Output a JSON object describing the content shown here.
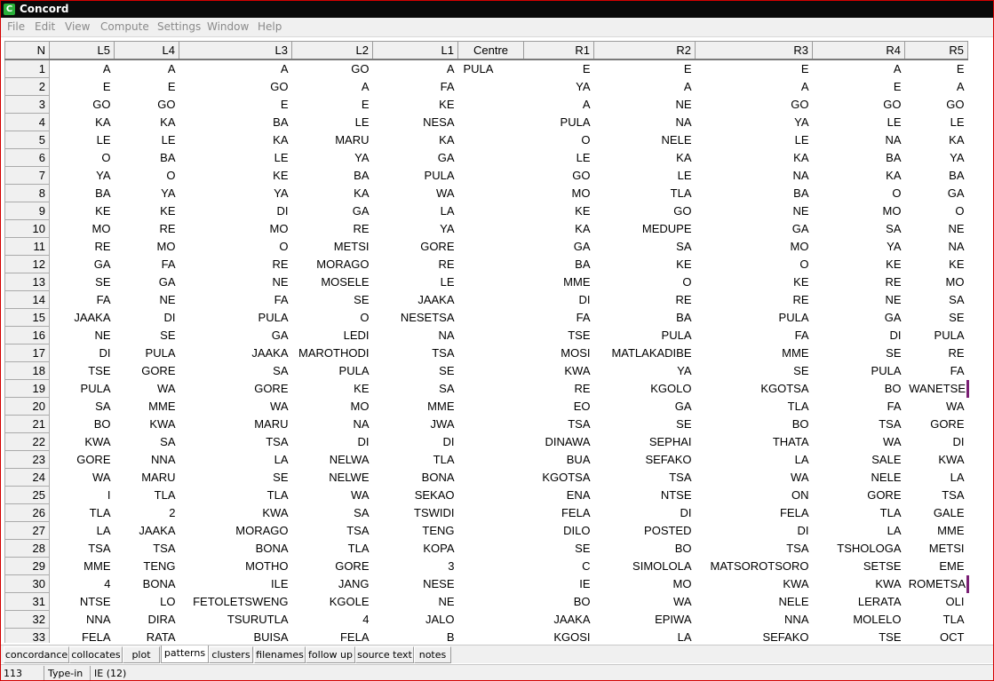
{
  "window": {
    "title": "Concord",
    "icon_letter": "C"
  },
  "menu": [
    "File",
    "Edit",
    "View",
    "Compute",
    "Settings",
    "Window",
    "Help"
  ],
  "columns": [
    "N",
    "L5",
    "L4",
    "L3",
    "L2",
    "L1",
    "Centre",
    "R1",
    "R2",
    "R3",
    "R4",
    "R5"
  ],
  "centre_word": "PULA",
  "rows": [
    [
      "1",
      "A",
      "A",
      "A",
      "GO",
      "A",
      "PULA",
      "E",
      "E",
      "E",
      "A",
      "E"
    ],
    [
      "2",
      "E",
      "E",
      "GO",
      "A",
      "FA",
      "",
      "YA",
      "A",
      "A",
      "E",
      "A"
    ],
    [
      "3",
      "GO",
      "GO",
      "E",
      "E",
      "KE",
      "",
      "A",
      "NE",
      "GO",
      "GO",
      "GO"
    ],
    [
      "4",
      "KA",
      "KA",
      "BA",
      "LE",
      "NESA",
      "",
      "PULA",
      "NA",
      "YA",
      "LE",
      "LE"
    ],
    [
      "5",
      "LE",
      "LE",
      "KA",
      "MARU",
      "KA",
      "",
      "O",
      "NELE",
      "LE",
      "NA",
      "KA"
    ],
    [
      "6",
      "O",
      "BA",
      "LE",
      "YA",
      "GA",
      "",
      "LE",
      "KA",
      "KA",
      "BA",
      "YA"
    ],
    [
      "7",
      "YA",
      "O",
      "KE",
      "BA",
      "PULA",
      "",
      "GO",
      "LE",
      "NA",
      "KA",
      "BA"
    ],
    [
      "8",
      "BA",
      "YA",
      "YA",
      "KA",
      "WA",
      "",
      "MO",
      "TLA",
      "BA",
      "O",
      "GA"
    ],
    [
      "9",
      "KE",
      "KE",
      "DI",
      "GA",
      "LA",
      "",
      "KE",
      "GO",
      "NE",
      "MO",
      "O"
    ],
    [
      "10",
      "MO",
      "RE",
      "MO",
      "RE",
      "YA",
      "",
      "KA",
      "MEDUPE",
      "GA",
      "SA",
      "NE"
    ],
    [
      "11",
      "RE",
      "MO",
      "O",
      "METSI",
      "GORE",
      "",
      "GA",
      "SA",
      "MO",
      "YA",
      "NA"
    ],
    [
      "12",
      "GA",
      "FA",
      "RE",
      "MORAGO",
      "RE",
      "",
      "BA",
      "KE",
      "O",
      "KE",
      "KE"
    ],
    [
      "13",
      "SE",
      "GA",
      "NE",
      "MOSELE",
      "LE",
      "",
      "MME",
      "O",
      "KE",
      "RE",
      "MO"
    ],
    [
      "14",
      "FA",
      "NE",
      "FA",
      "SE",
      "JAAKA",
      "",
      "DI",
      "RE",
      "RE",
      "NE",
      "SA"
    ],
    [
      "15",
      "JAAKA",
      "DI",
      "PULA",
      "O",
      "NESETSA",
      "",
      "FA",
      "BA",
      "PULA",
      "GA",
      "SE"
    ],
    [
      "16",
      "NE",
      "SE",
      "GA",
      "LEDI",
      "NA",
      "",
      "TSE",
      "PULA",
      "FA",
      "DI",
      "PULA"
    ],
    [
      "17",
      "DI",
      "PULA",
      "JAAKA",
      "MAROTHODI",
      "TSA",
      "",
      "MOSI",
      "MATLAKADIBE",
      "MME",
      "SE",
      "RE"
    ],
    [
      "18",
      "TSE",
      "GORE",
      "SA",
      "PULA",
      "SE",
      "",
      "KWA",
      "YA",
      "SE",
      "PULA",
      "FA"
    ],
    [
      "19",
      "PULA",
      "WA",
      "GORE",
      "KE",
      "SA",
      "",
      "RE",
      "KGOLO",
      "KGOTSA",
      "BO",
      "WANETSE"
    ],
    [
      "20",
      "SA",
      "MME",
      "WA",
      "MO",
      "MME",
      "",
      "EO",
      "GA",
      "TLA",
      "FA",
      "WA"
    ],
    [
      "21",
      "BO",
      "KWA",
      "MARU",
      "NA",
      "JWA",
      "",
      "TSA",
      "SE",
      "BO",
      "TSA",
      "GORE"
    ],
    [
      "22",
      "KWA",
      "SA",
      "TSA",
      "DI",
      "DI",
      "",
      "DINAWA",
      "SEPHAI",
      "THATA",
      "WA",
      "DI"
    ],
    [
      "23",
      "GORE",
      "NNA",
      "LA",
      "NELWA",
      "TLA",
      "",
      "BUA",
      "SEFAKO",
      "LA",
      "SALE",
      "KWA"
    ],
    [
      "24",
      "WA",
      "MARU",
      "SE",
      "NELWE",
      "BONA",
      "",
      "KGOTSA",
      "TSA",
      "WA",
      "NELE",
      "LA"
    ],
    [
      "25",
      "I",
      "TLA",
      "TLA",
      "WA",
      "SEKAO",
      "",
      "ENA",
      "NTSE",
      "ON",
      "GORE",
      "TSA"
    ],
    [
      "26",
      "TLA",
      "2",
      "KWA",
      "SA",
      "TSWIDI",
      "",
      "FELA",
      "DI",
      "FELA",
      "TLA",
      "GALE"
    ],
    [
      "27",
      "LA",
      "JAAKA",
      "MORAGO",
      "TSA",
      "TENG",
      "",
      "DILO",
      "POSTED",
      "DI",
      "LA",
      "MME"
    ],
    [
      "28",
      "TSA",
      "TSA",
      "BONA",
      "TLA",
      "KOPA",
      "",
      "SE",
      "BO",
      "TSA",
      "TSHOLOGA",
      "METSI"
    ],
    [
      "29",
      "MME",
      "TENG",
      "MOTHO",
      "GORE",
      "3",
      "",
      "C",
      "SIMOLOLA",
      "MATSOROTSORO",
      "SETSE",
      "EME"
    ],
    [
      "30",
      "4",
      "BONA",
      "ILE",
      "JANG",
      "NESE",
      "",
      "IE",
      "MO",
      "KWA",
      "KWA",
      "ROMETSA"
    ],
    [
      "31",
      "NTSE",
      "LO",
      "FETOLETSWENG",
      "KGOLE",
      "NE",
      "",
      "BO",
      "WA",
      "NELE",
      "LERATA",
      "OLI"
    ],
    [
      "32",
      "NNA",
      "DIRA",
      "TSURUTLA",
      "4",
      "JALO",
      "",
      "JAAKA",
      "EPIWA",
      "NNA",
      "MOLELO",
      "TLA"
    ],
    [
      "33",
      "FELA",
      "RATA",
      "BUISA",
      "FELA",
      "B",
      "",
      "KGOSI",
      "LA",
      "SEFAKO",
      "TSE",
      "OCT"
    ]
  ],
  "tabs": [
    "concordance",
    "collocates",
    "plot",
    "patterns",
    "clusters",
    "filenames",
    "follow up",
    "source text",
    "notes"
  ],
  "active_tab": "patterns",
  "status": {
    "count": "113",
    "mode": "Type-in",
    "info": "IE (12)"
  },
  "colors": {
    "titlebar": "#0a0a0a",
    "frame": "#d40000",
    "marker": "#7a1f74",
    "icon": "#2ab03a"
  }
}
